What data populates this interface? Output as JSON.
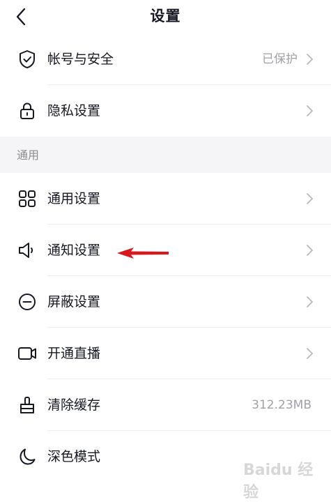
{
  "header": {
    "title": "设置",
    "back_icon": "chevron-left-icon"
  },
  "rows_top": [
    {
      "label": "帐号与安全",
      "value": "已保护",
      "icon": "shield-check-icon"
    },
    {
      "label": "隐私设置",
      "value": "",
      "icon": "lock-icon"
    }
  ],
  "section": {
    "title": "通用"
  },
  "rows_general": [
    {
      "label": "通用设置",
      "value": "",
      "icon": "grid-icon"
    },
    {
      "label": "通知设置",
      "value": "",
      "icon": "speaker-icon"
    },
    {
      "label": "屏蔽设置",
      "value": "",
      "icon": "block-icon"
    },
    {
      "label": "开通直播",
      "value": "",
      "icon": "video-camera-icon"
    },
    {
      "label": "清除缓存",
      "value": "312.23MB",
      "icon": "broom-icon"
    },
    {
      "label": "深色模式",
      "value": "",
      "icon": "moon-icon"
    }
  ],
  "annotation": {
    "arrow_color": "#d7191f"
  },
  "watermark": {
    "text": "Baidu 经验"
  },
  "colors": {
    "text_primary": "#161823",
    "text_secondary": "#a0a1a7",
    "section_bg": "#f5f5f7",
    "divider": "#efeff1"
  }
}
